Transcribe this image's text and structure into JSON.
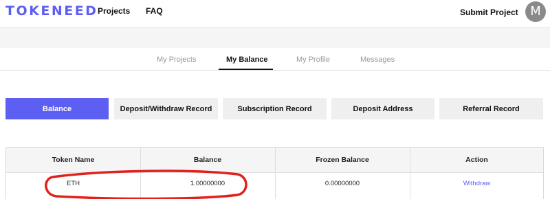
{
  "header": {
    "logo": "TOKENEED",
    "nav": {
      "projects": "Projects",
      "faq": "FAQ"
    },
    "submit_project": "Submit Project",
    "avatar_initial": "M"
  },
  "subtabs": {
    "items": [
      "My Projects",
      "My Balance",
      "My Profile",
      "Messages"
    ],
    "active": "My Balance"
  },
  "section_buttons": {
    "items": [
      "Balance",
      "Deposit/Withdraw Record",
      "Subscription Record",
      "Deposit Address",
      "Referral Record"
    ],
    "active": "Balance"
  },
  "table": {
    "headers": [
      "Token Name",
      "Balance",
      "Frozen Balance",
      "Action"
    ],
    "rows": [
      {
        "token": "ETH",
        "balance": "1.00000000",
        "frozen": "0.00000000",
        "action": "Withdraw"
      }
    ]
  },
  "colors": {
    "accent": "#5d5ff2",
    "annotation": "#e3211c",
    "band": "#f5f5f5",
    "button_bg": "#efefef"
  }
}
